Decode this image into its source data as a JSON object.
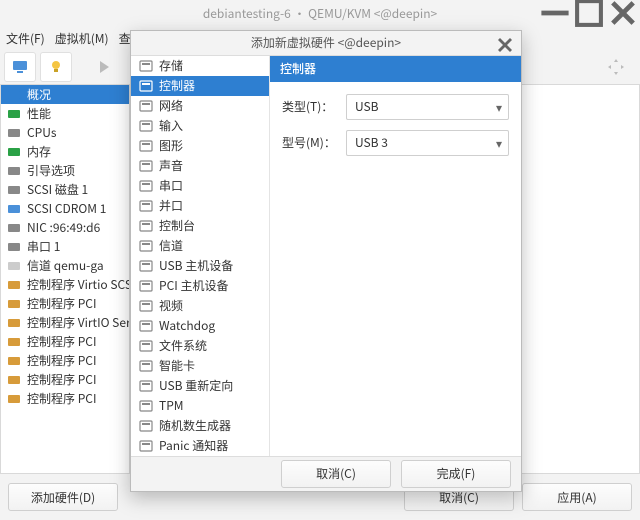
{
  "window": {
    "title": "debiantesting-6 · QEMU/KVM <@deepin>"
  },
  "menu": {
    "file": "文件(F)",
    "vm": "虚拟机(M)",
    "view": "查看"
  },
  "hardware_list": {
    "items": [
      "概况",
      "性能",
      "CPUs",
      "内存",
      "引导选项",
      "SCSI 磁盘 1",
      "SCSI CDROM 1",
      "NIC :96:49:d6",
      "串口 1",
      "信道 qemu-ga",
      "控制程序 Virtio SCSI",
      "控制程序 PCI",
      "控制程序 VirtIO Serial",
      "控制程序 PCI",
      "控制程序 PCI",
      "控制程序 PCI",
      "控制程序 PCI"
    ],
    "selected_index": 0
  },
  "main_buttons": {
    "add_hw": "添加硬件(D)",
    "cancel": "取消(C)",
    "apply": "应用(A)"
  },
  "dialog": {
    "title": "添加新虚拟硬件 <@deepin>",
    "categories": [
      "存储",
      "控制器",
      "网络",
      "输入",
      "图形",
      "声音",
      "串口",
      "并口",
      "控制台",
      "信道",
      "USB 主机设备",
      "PCI 主机设备",
      "视频",
      "Watchdog",
      "文件系统",
      "智能卡",
      "USB 重新定向",
      "TPM",
      "随机数生成器",
      "Panic 通知器"
    ],
    "selected_index": 1,
    "form": {
      "heading": "控制器",
      "type_label": "类型(T)：",
      "type_value": "USB",
      "model_label": "型号(M)：",
      "model_value": "USB 3"
    },
    "buttons": {
      "cancel": "取消(C)",
      "finish": "完成(F)"
    }
  }
}
